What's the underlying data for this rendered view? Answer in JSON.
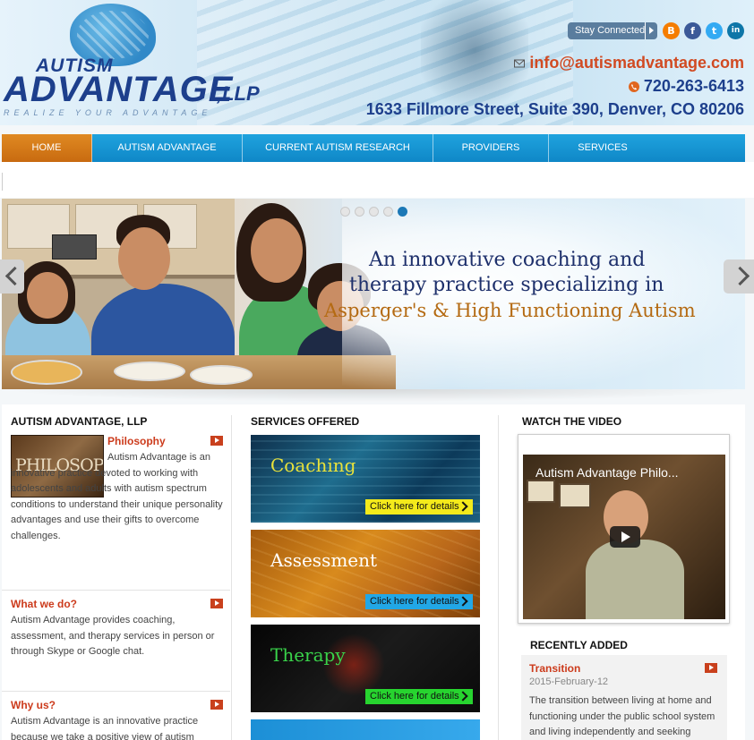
{
  "header": {
    "logo_autism": "AUTISM",
    "logo_advantage": "ADVANTAGE",
    "logo_llp": ",LLP",
    "logo_tagline": "REALIZE YOUR ADVANTAGE",
    "stay_connected": "Stay Connected",
    "email": "info@autismadvantage.com",
    "phone": "720-263-6413",
    "address": "1633 Fillmore Street, Suite 390, Denver, CO 80206",
    "social": [
      {
        "name": "blogger-icon",
        "glyph": "B",
        "color": "#f57d00"
      },
      {
        "name": "facebook-icon",
        "glyph": "f",
        "color": "#3b5998"
      },
      {
        "name": "twitter-icon",
        "glyph": "t",
        "color": "#33aaf3"
      },
      {
        "name": "linkedin-icon",
        "glyph": "in",
        "color": "#0e76a8"
      }
    ]
  },
  "nav": {
    "items": [
      {
        "label": "HOME",
        "active": true
      },
      {
        "label": "AUTISM ADVANTAGE"
      },
      {
        "label": "CURRENT AUTISM RESEARCH"
      },
      {
        "label": "PROVIDERS"
      },
      {
        "label": "SERVICES"
      }
    ]
  },
  "slider": {
    "line1": "An innovative coaching and",
    "line2": "therapy practice specializing in",
    "line3": "Asperger's & High Functioning Autism",
    "slide_count": 5,
    "active_slide": 5
  },
  "col1": {
    "heading": "AUTISM ADVANTAGE, LLP",
    "image_text": "PHILOSOPHY",
    "philosophy_title": "Philosophy",
    "philosophy_text": "Autism Advantage is an innovative practice devoted to working with adolescents and adults with autism spectrum conditions to understand their unique personality advantages and use their gifts to overcome challenges.",
    "what_title": "What we do?",
    "what_text": "Autism Advantage provides coaching, assessment, and therapy services in person or through Skype or Google chat.",
    "why_title": "Why us?",
    "why_text": "Autism Advantage is an innovative practice because we take a positive view of autism"
  },
  "col2": {
    "heading": "SERVICES OFFERED",
    "services": [
      {
        "title": "Coaching",
        "button": "Click here for details",
        "title_color": "#e9e23a",
        "button_color": "#f4ea1b"
      },
      {
        "title": "Assessment",
        "button": "Click here for details",
        "title_color": "#ffffff",
        "button_color": "#22a7e6"
      },
      {
        "title": "Therapy",
        "button": "Click here for details",
        "title_color": "#39d24a",
        "button_color": "#27d42f"
      }
    ]
  },
  "col3": {
    "heading": "WATCH THE VIDEO",
    "video_title": "Autism Advantage Philo...",
    "recent_heading": "RECENTLY ADDED",
    "recent_title": "Transition",
    "recent_date": "2015-February-12",
    "recent_text": "The transition between living at home and functioning under the public school system and living independently and seeking"
  }
}
